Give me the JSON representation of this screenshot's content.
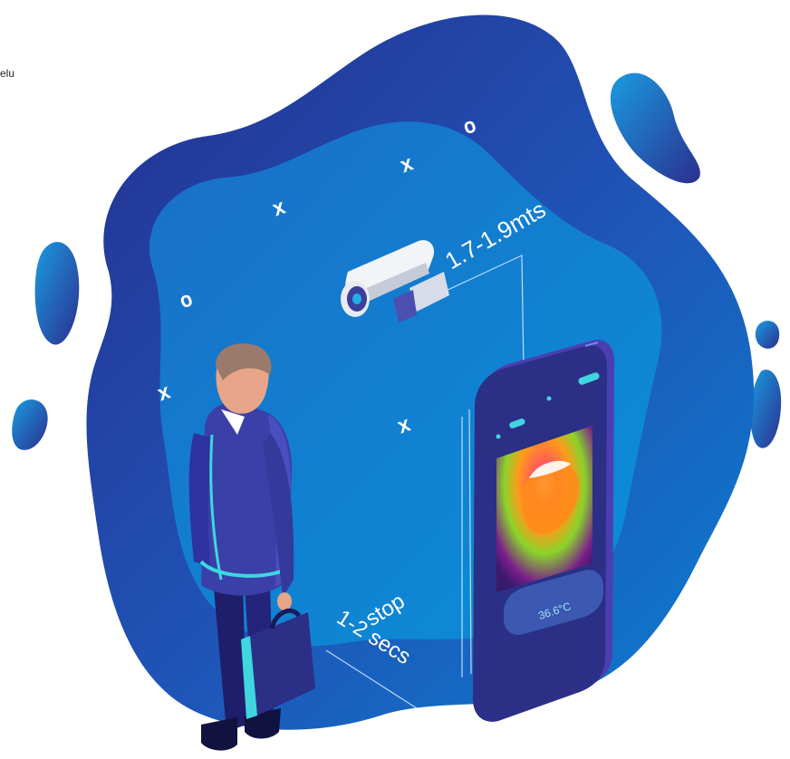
{
  "corner_text": "elu",
  "distance_label": "1.7-1.9mts",
  "stop_label": "stop",
  "duration_label": "1-2 secs",
  "temperature_reading": "36.6°C",
  "markers": [
    "x",
    "x",
    "x",
    "x",
    "o",
    "o"
  ],
  "colors": {
    "blob_outer": "#2e3a9e",
    "blob_inner": "#0a85d4",
    "device_body": "#3a2f9c",
    "device_screen": "#2b2f86",
    "accent_cyan": "#3fd6e0",
    "suit": "#3b3fa8",
    "hair": "#9a7a6a"
  }
}
